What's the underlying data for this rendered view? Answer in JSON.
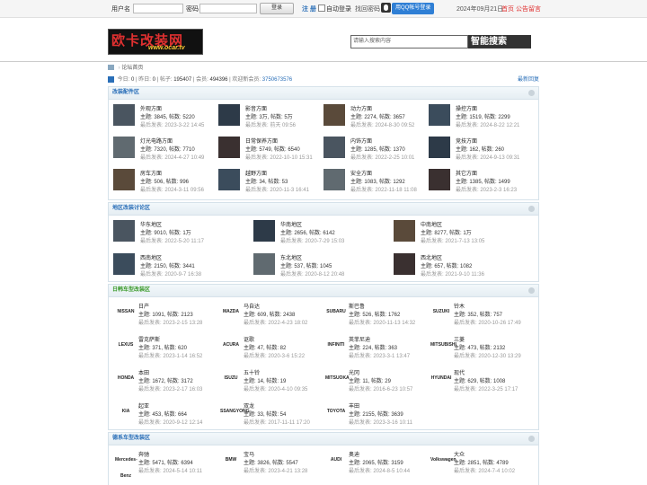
{
  "topbar": {
    "username_label": "用户名",
    "password_label": "密码",
    "login_button": "登录",
    "register_link": "注 册",
    "auto_login_label": "自动登录",
    "forgot_password_link": "找回密码",
    "qq_login_button": "用QQ帐号登录",
    "date_text": "2024年09月21日",
    "home_link": "首页",
    "announcement_link": "公告留言"
  },
  "header": {
    "logo_text": "欧卡改装网",
    "logo_url_text": "www.ocar.tv",
    "search_placeholder": "请输入搜索内容",
    "search_button": "智能搜索"
  },
  "breadcrumb": {
    "item": "论坛首页"
  },
  "stats": {
    "today_label": "今日:",
    "today": "0",
    "yesterday_label": "昨日:",
    "yesterday": "0",
    "posts_label": "帖子:",
    "posts": "195407",
    "members_label": "会员:",
    "members": "494396",
    "welcome_label": "欢迎新会员:",
    "new_member": "3750673576",
    "latest_reply": "最新回复"
  },
  "sections": [
    {
      "title": "改装配件区",
      "forums": [
        {
          "name": "外观方面",
          "stats": "主题: 3845, 帖数: 5220",
          "last": "最后发表: 2023-3-22 14:45"
        },
        {
          "name": "影音方面",
          "stats": "主题: 3万, 帖数: 5万",
          "last": "最后发表: 前天 09:56"
        },
        {
          "name": "动力方面",
          "stats": "主题: 2274, 帖数: 3657",
          "last": "最后发表: 2024-8-30 09:52"
        },
        {
          "name": "操控方面",
          "stats": "主题: 1519, 帖数: 2299",
          "last": "最后发表: 2024-8-22 12:21"
        },
        {
          "name": "灯光电路方面",
          "stats": "主题: 7320, 帖数: 7710",
          "last": "最后发表: 2024-4-27 10:49"
        },
        {
          "name": "日常保养方面",
          "stats": "主题: 5749, 帖数: 6540",
          "last": "最后发表: 2022-10-10 15:31"
        },
        {
          "name": "内饰方面",
          "stats": "主题: 1285, 帖数: 1370",
          "last": "最后发表: 2022-2-25 10:01"
        },
        {
          "name": "竞技方面",
          "stats": "主题: 162, 帖数: 260",
          "last": "最后发表: 2024-9-13 09:31"
        },
        {
          "name": "房车方面",
          "stats": "主题: 506, 帖数: 996",
          "last": "最后发表: 2024-3-11 09:56"
        },
        {
          "name": "越野方面",
          "stats": "主题: 34, 帖数: 53",
          "last": "最后发表: 2020-11-3 16:41"
        },
        {
          "name": "安全方面",
          "stats": "主题: 1083, 帖数: 1292",
          "last": "最后发表: 2022-11-18 11:08"
        },
        {
          "name": "其它方面",
          "stats": "主题: 1385, 帖数: 1499",
          "last": "最后发表: 2023-2-3 16:23"
        }
      ]
    },
    {
      "title": "地区改装讨论区",
      "forums": [
        {
          "name": "华东地区",
          "stats": "主题: 9010, 帖数: 1万",
          "last": "最后发表: 2022-5-20 11:17"
        },
        {
          "name": "华南地区",
          "stats": "主题: 2656, 帖数: 6142",
          "last": "最后发表: 2020-7-29 15:03"
        },
        {
          "name": "中南地区",
          "stats": "主题: 8277, 帖数: 1万",
          "last": "最后发表: 2021-7-13 13:05"
        },
        {
          "name": "西南地区",
          "stats": "主题: 2150, 帖数: 3441",
          "last": "最后发表: 2020-9-7 16:38"
        },
        {
          "name": "东北地区",
          "stats": "主题: 537, 帖数: 1045",
          "last": "最后发表: 2020-8-12 20:48"
        },
        {
          "name": "西北地区",
          "stats": "主题: 657, 帖数: 1082",
          "last": "最后发表: 2021-9-10 11:36"
        }
      ]
    },
    {
      "title": "日韩车型改装区",
      "forums": [
        {
          "name": "日产",
          "logo": "NISSAN",
          "stats": "主题: 1091, 帖数: 2123",
          "last": "最后发表: 2023-2-15 13:28"
        },
        {
          "name": "马自达",
          "logo": "MAZDA",
          "stats": "主题: 609, 帖数: 2438",
          "last": "最后发表: 2022-4-23 18:02"
        },
        {
          "name": "斯巴鲁",
          "logo": "SUBARU",
          "stats": "主题: 526, 帖数: 1762",
          "last": "最后发表: 2020-11-13 14:32"
        },
        {
          "name": "铃木",
          "logo": "SUZUKI",
          "stats": "主题: 352, 帖数: 757",
          "last": "最后发表: 2020-10-26 17:49"
        },
        {
          "name": "雷克萨斯",
          "logo": "LEXUS",
          "stats": "主题: 371, 帖数: 620",
          "last": "最后发表: 2023-1-14 16:52"
        },
        {
          "name": "讴歌",
          "logo": "ACURA",
          "stats": "主题: 47, 帖数: 82",
          "last": "最后发表: 2020-3-6 15:22"
        },
        {
          "name": "英菲尼迪",
          "logo": "INFINITI",
          "stats": "主题: 224, 帖数: 363",
          "last": "最后发表: 2023-3-1 13:47"
        },
        {
          "name": "三菱",
          "logo": "MITSUBISHI",
          "stats": "主题: 473, 帖数: 2132",
          "last": "最后发表: 2020-12-30 13:29"
        },
        {
          "name": "本田",
          "logo": "HONDA",
          "stats": "主题: 1672, 帖数: 3172",
          "last": "最后发表: 2023-2-17 16:03"
        },
        {
          "name": "五十铃",
          "logo": "ISUZU",
          "stats": "主题: 14, 帖数: 19",
          "last": "最后发表: 2020-4-10 09:35"
        },
        {
          "name": "光冈",
          "logo": "MITSUOKA",
          "stats": "主题: 11, 帖数: 29",
          "last": "最后发表: 2016-6-23 10:57"
        },
        {
          "name": "现代",
          "logo": "HYUNDAI",
          "stats": "主题: 629, 帖数: 1008",
          "last": "最后发表: 2022-3-25 17:17"
        },
        {
          "name": "起亚",
          "logo": "KIA",
          "stats": "主题: 453, 帖数: 664",
          "last": "最后发表: 2020-9-12 12:14"
        },
        {
          "name": "双龙",
          "logo": "SSANGYONG",
          "stats": "主题: 33, 帖数: 54",
          "last": "最后发表: 2017-11-11 17:20"
        },
        {
          "name": "丰田",
          "logo": "TOYOTA",
          "stats": "主题: 2155, 帖数: 3639",
          "last": "最后发表: 2023-3-16 10:11"
        }
      ]
    },
    {
      "title": "德系车型改装区",
      "forums": [
        {
          "name": "奔驰",
          "logo": "Mercedes-Benz",
          "stats": "主题: 5471, 帖数: 6394",
          "last": "最后发表: 2024-5-14 10:11"
        },
        {
          "name": "宝马",
          "logo": "BMW",
          "stats": "主题: 3826, 帖数: 5547",
          "last": "最后发表: 2023-4-21 13:28"
        },
        {
          "name": "奥迪",
          "logo": "AUDI",
          "stats": "主题: 2065, 帖数: 3159",
          "last": "最后发表: 2024-8-5 10:44"
        },
        {
          "name": "大众",
          "logo": "Volkswagen",
          "stats": "主题: 2851, 帖数: 4789",
          "last": "最后发表: 2024-7-4 10:02"
        }
      ]
    }
  ],
  "colors": {
    "link_blue": "#2a6fb8",
    "red": "#e03030",
    "green": "#3a9a2a",
    "qq_blue": "#2f7fd5"
  }
}
